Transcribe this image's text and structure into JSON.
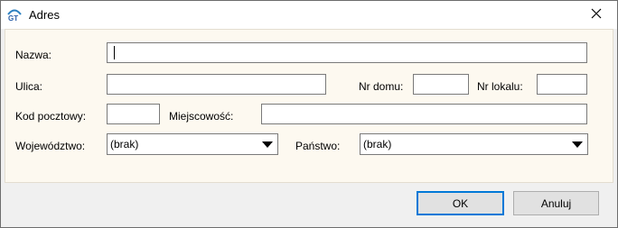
{
  "window": {
    "title": "Adres",
    "app_icon": "gt-app-icon",
    "close_icon": "close-icon"
  },
  "form": {
    "nazwa": {
      "label": "Nazwa:",
      "value": ""
    },
    "ulica": {
      "label": "Ulica:",
      "value": ""
    },
    "nr_domu": {
      "label": "Nr domu:",
      "value": ""
    },
    "nr_lokalu": {
      "label": "Nr lokalu:",
      "value": ""
    },
    "kod_pocztowy": {
      "label": "Kod pocztowy:",
      "value": ""
    },
    "miejscowosc": {
      "label": "Miejscowość:",
      "value": ""
    },
    "wojewodztwo": {
      "label": "Województwo:",
      "selected": "(brak)"
    },
    "panstwo": {
      "label": "Państwo:",
      "selected": "(brak)"
    }
  },
  "buttons": {
    "ok": "OK",
    "cancel": "Anuluj"
  },
  "colors": {
    "content_bg": "#fdf9f0",
    "default_button_border": "#0078d7"
  }
}
